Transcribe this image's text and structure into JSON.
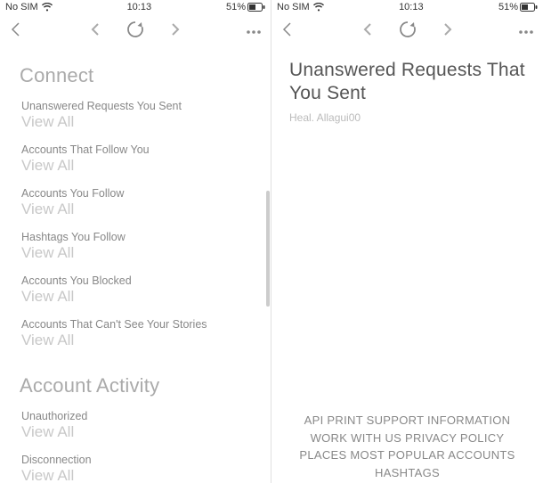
{
  "left": {
    "status": {
      "carrier": "No SIM",
      "time": "10:13",
      "battery": "51%"
    },
    "heading_connect": "Connect",
    "heading_activity": "Account Activity",
    "connect_items": [
      {
        "title": "Unanswered Requests You Sent",
        "action": "View All"
      },
      {
        "title": "Accounts That Follow You",
        "action": "View All"
      },
      {
        "title": "Accounts You Follow",
        "action": "View All"
      },
      {
        "title": "Hashtags You Follow",
        "action": "View All"
      },
      {
        "title": "Accounts You Blocked",
        "action": "View All"
      },
      {
        "title": "Accounts That Can't See Your Stories",
        "action": "View All"
      }
    ],
    "activity_items": [
      {
        "title": "Unauthorized",
        "action": "View All"
      },
      {
        "title": "Disconnection",
        "action": "View All"
      }
    ]
  },
  "right": {
    "status": {
      "carrier": "No SIM",
      "time": "10:13",
      "battery": "51%"
    },
    "title_line1": "Unanswered Requests That",
    "title_line2": "You Sent",
    "subtitle": "Heal. Allagui00",
    "footer_line1": "API PRINT SUPPORT INFORMATION",
    "footer_line2": "WORK WITH US PRIVACY POLICY",
    "footer_line3": "PLACES MOST POPULAR ACCOUNTS HASHTAGS"
  }
}
